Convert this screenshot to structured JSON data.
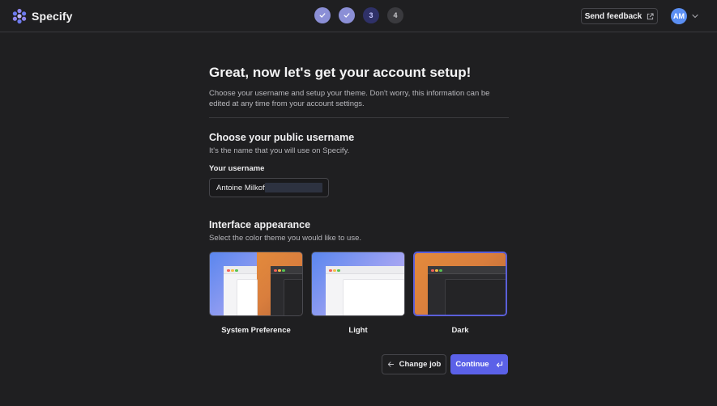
{
  "app": {
    "brand": "Specify"
  },
  "header": {
    "steps": [
      {
        "label": "",
        "state": "done"
      },
      {
        "label": "",
        "state": "done"
      },
      {
        "label": "3",
        "state": "current"
      },
      {
        "label": "4",
        "state": "todo"
      }
    ],
    "feedback_label": "Send feedback",
    "avatar_initials": "AM"
  },
  "main": {
    "title": "Great, now let's get your account setup!",
    "description": "Choose your username and setup your theme. Don't worry, this information can be edited at any time from your account settings.",
    "username_section": {
      "title": "Choose your public username",
      "subtitle": "It's the name that you will use on Specify.",
      "field_label": "Your username",
      "value": "Antoine Milkoff"
    },
    "appearance_section": {
      "title": "Interface appearance",
      "subtitle": "Select the color theme you would like to use.",
      "themes": [
        {
          "label": "System Preference",
          "selected": false
        },
        {
          "label": "Light",
          "selected": false
        },
        {
          "label": "Dark",
          "selected": true
        }
      ]
    }
  },
  "footer": {
    "back_label": "Change job",
    "continue_label": "Continue"
  },
  "colors": {
    "accent": "#5b61e8",
    "background": "#1f1f21",
    "step_done": "#8b8fd6",
    "avatar": "#5b8ff3"
  },
  "icons": [
    "specify-logo-icon",
    "check-icon",
    "external-link-icon",
    "chevron-down-icon",
    "arrow-left-icon",
    "enter-icon"
  ]
}
